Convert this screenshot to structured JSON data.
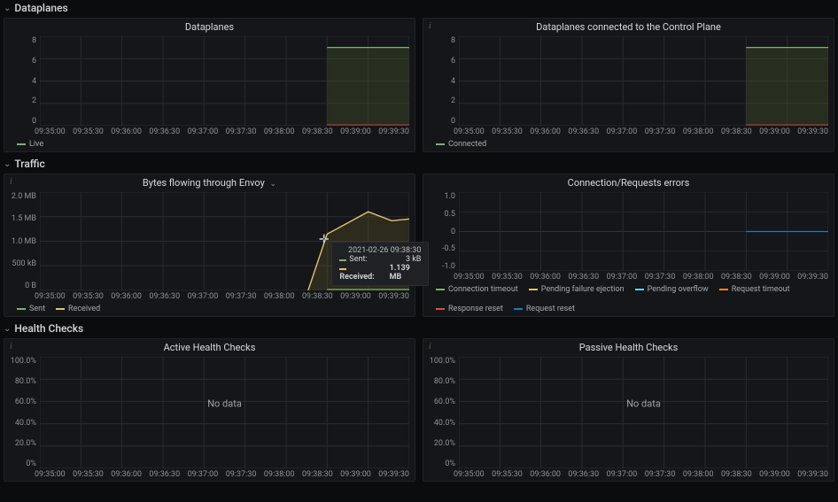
{
  "sections": {
    "dataplanes": "Dataplanes",
    "traffic": "Traffic",
    "health": "Health Checks"
  },
  "panels": {
    "dataplanes": {
      "title": "Dataplanes",
      "yticks": [
        "8",
        "6",
        "4",
        "2",
        "0"
      ],
      "legend": [
        {
          "label": "Live",
          "color": "#7eb26d"
        }
      ]
    },
    "connected": {
      "title": "Dataplanes connected to the Control Plane",
      "yticks": [
        "8",
        "6",
        "4",
        "2",
        "0"
      ],
      "legend": [
        {
          "label": "Connected",
          "color": "#7eb26d"
        }
      ]
    },
    "bytes": {
      "title": "Bytes flowing through Envoy",
      "yticks": [
        "2.0 MB",
        "1.5 MB",
        "1.0 MB",
        "500 kB",
        "0 B"
      ],
      "legend": [
        {
          "label": "Sent",
          "color": "#7eb26d"
        },
        {
          "label": "Received",
          "color": "#e5c06e"
        }
      ],
      "tooltip": {
        "time": "2021-02-26 09:38:30",
        "rows": [
          {
            "swatch": "#7eb26d",
            "label": "Sent:",
            "value": "3 kB",
            "bold": false
          },
          {
            "swatch": "#e5c06e",
            "label": "Received:",
            "value": "1.139 MB",
            "bold": true
          }
        ]
      }
    },
    "errors": {
      "title": "Connection/Requests errors",
      "yticks": [
        "1.0",
        "0.5",
        "0",
        "-0.5",
        "-1.0"
      ],
      "legend": [
        {
          "label": "Connection timeout",
          "color": "#7eb26d"
        },
        {
          "label": "Pending failure ejection",
          "color": "#e5c06e"
        },
        {
          "label": "Pending overflow",
          "color": "#6ed0e0"
        },
        {
          "label": "Request timeout",
          "color": "#ef843c"
        },
        {
          "label": "Response reset",
          "color": "#e24d42"
        },
        {
          "label": "Request reset",
          "color": "#1f78c1"
        }
      ]
    },
    "active_hc": {
      "title": "Active Health Checks",
      "yticks": [
        "100.0%",
        "80.0%",
        "60.0%",
        "40.0%",
        "20.0%",
        "0%"
      ],
      "nodata": "No data"
    },
    "passive_hc": {
      "title": "Passive Health Checks",
      "yticks": [
        "100.0%",
        "80.0%",
        "60.0%",
        "40.0%",
        "20.0%",
        "0%"
      ],
      "nodata": "No data"
    }
  },
  "xticks": [
    "09:35:00",
    "09:35:30",
    "09:36:00",
    "09:36:30",
    "09:37:00",
    "09:37:30",
    "09:38:00",
    "09:38:30",
    "09:39:00",
    "09:39:30"
  ],
  "chart_data": [
    {
      "panel": "dataplanes",
      "type": "line",
      "title": "Dataplanes",
      "x": [
        "09:35:00",
        "09:35:30",
        "09:36:00",
        "09:36:30",
        "09:37:00",
        "09:37:30",
        "09:38:00",
        "09:38:30",
        "09:39:00",
        "09:39:30"
      ],
      "series": [
        {
          "name": "Live",
          "color": "#7eb26d",
          "values": [
            null,
            null,
            null,
            null,
            null,
            null,
            null,
            7,
            7,
            7
          ]
        }
      ],
      "ylim": [
        0,
        8
      ],
      "ylabel": "",
      "xlabel": ""
    },
    {
      "panel": "connected",
      "type": "line",
      "title": "Dataplanes connected to the Control Plane",
      "x": [
        "09:35:00",
        "09:35:30",
        "09:36:00",
        "09:36:30",
        "09:37:00",
        "09:37:30",
        "09:38:00",
        "09:38:30",
        "09:39:00",
        "09:39:30"
      ],
      "series": [
        {
          "name": "Connected",
          "color": "#7eb26d",
          "values": [
            null,
            null,
            null,
            null,
            null,
            null,
            null,
            7,
            7,
            7
          ]
        }
      ],
      "ylim": [
        0,
        8
      ],
      "ylabel": "",
      "xlabel": ""
    },
    {
      "panel": "bytes",
      "type": "line",
      "title": "Bytes flowing through Envoy",
      "x": [
        "09:35:00",
        "09:35:30",
        "09:36:00",
        "09:36:30",
        "09:37:00",
        "09:37:30",
        "09:38:00",
        "09:38:30",
        "09:39:00",
        "09:39:30"
      ],
      "yunit": "bytes",
      "series": [
        {
          "name": "Sent",
          "color": "#7eb26d",
          "values": [
            null,
            null,
            null,
            null,
            null,
            null,
            null,
            3000,
            3000,
            3000
          ]
        },
        {
          "name": "Received",
          "color": "#e5c06e",
          "values": [
            null,
            null,
            null,
            null,
            null,
            null,
            null,
            1139000,
            1600000,
            1350000
          ]
        }
      ],
      "ylim": [
        0,
        2000000
      ],
      "ylabel": "",
      "xlabel": ""
    },
    {
      "panel": "errors",
      "type": "line",
      "title": "Connection/Requests errors",
      "x": [
        "09:35:00",
        "09:35:30",
        "09:36:00",
        "09:36:30",
        "09:37:00",
        "09:37:30",
        "09:38:00",
        "09:38:30",
        "09:39:00",
        "09:39:30"
      ],
      "series": [
        {
          "name": "Connection timeout",
          "color": "#7eb26d",
          "values": [
            null,
            null,
            null,
            null,
            null,
            null,
            null,
            0,
            0,
            0
          ]
        },
        {
          "name": "Pending failure ejection",
          "color": "#e5c06e",
          "values": [
            null,
            null,
            null,
            null,
            null,
            null,
            null,
            0,
            0,
            0
          ]
        },
        {
          "name": "Pending overflow",
          "color": "#6ed0e0",
          "values": [
            null,
            null,
            null,
            null,
            null,
            null,
            null,
            0,
            0,
            0
          ]
        },
        {
          "name": "Request timeout",
          "color": "#ef843c",
          "values": [
            null,
            null,
            null,
            null,
            null,
            null,
            null,
            0,
            0,
            0
          ]
        },
        {
          "name": "Response reset",
          "color": "#e24d42",
          "values": [
            null,
            null,
            null,
            null,
            null,
            null,
            null,
            0,
            0,
            0
          ]
        },
        {
          "name": "Request reset",
          "color": "#1f78c1",
          "values": [
            null,
            null,
            null,
            null,
            null,
            null,
            null,
            0,
            0,
            0
          ]
        }
      ],
      "ylim": [
        -1,
        1
      ],
      "ylabel": "",
      "xlabel": ""
    },
    {
      "panel": "active_hc",
      "type": "line",
      "title": "Active Health Checks",
      "x": [
        "09:35:00",
        "09:35:30",
        "09:36:00",
        "09:36:30",
        "09:37:00",
        "09:37:30",
        "09:38:00",
        "09:38:30",
        "09:39:00",
        "09:39:30"
      ],
      "series": [],
      "ylim": [
        0,
        100
      ],
      "ylabel": "%",
      "xlabel": ""
    },
    {
      "panel": "passive_hc",
      "type": "line",
      "title": "Passive Health Checks",
      "x": [
        "09:35:00",
        "09:35:30",
        "09:36:00",
        "09:36:30",
        "09:37:00",
        "09:37:30",
        "09:38:00",
        "09:38:30",
        "09:39:00",
        "09:39:30"
      ],
      "series": [],
      "ylim": [
        0,
        100
      ],
      "ylabel": "%",
      "xlabel": ""
    }
  ]
}
